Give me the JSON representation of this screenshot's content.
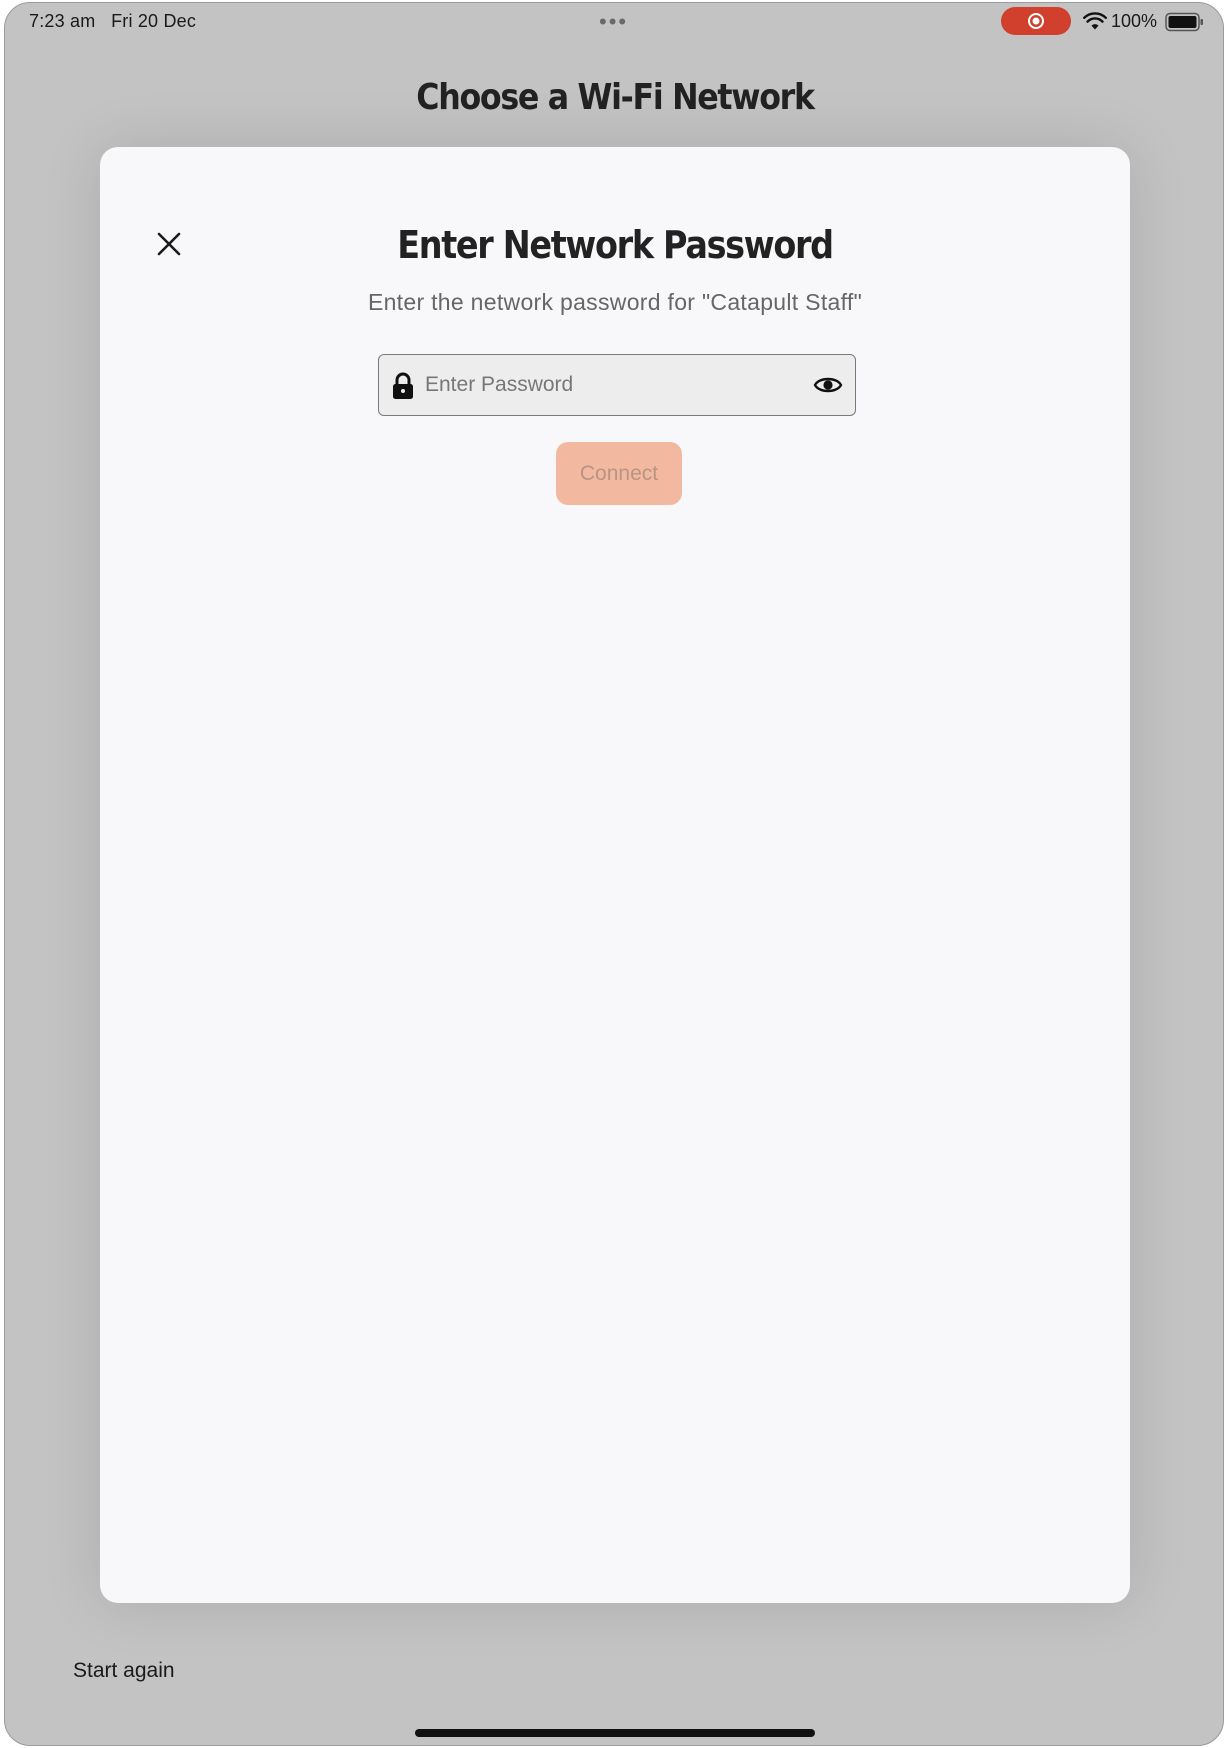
{
  "status_bar": {
    "time": "7:23 am",
    "date": "Fri 20 Dec",
    "battery_percent": "100%",
    "recording_color": "#d0402c",
    "icons": [
      "record-icon",
      "wifi-icon",
      "battery-icon"
    ]
  },
  "background": {
    "title": "Choose a Wi-Fi Network",
    "start_again_label": "Start again"
  },
  "modal": {
    "title": "Enter Network Password",
    "subtitle": "Enter the network password for \"Catapult Staff\"",
    "password_placeholder": "Enter Password",
    "password_value": "",
    "connect_label": "Connect",
    "connect_color": "#f3b9a0",
    "icons": [
      "close-icon",
      "lock-icon",
      "eye-icon"
    ]
  }
}
